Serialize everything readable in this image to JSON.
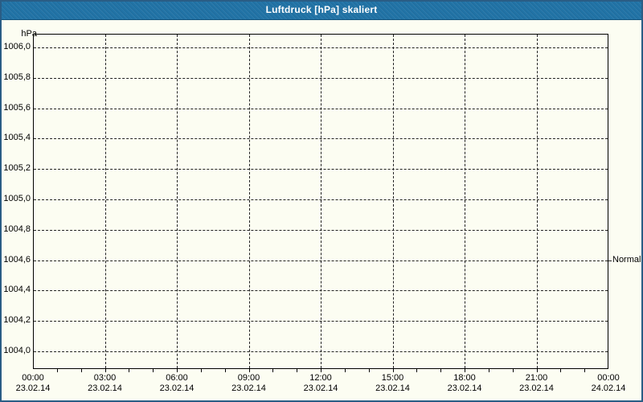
{
  "window": {
    "title": "Luftdruck [hPa] skaliert"
  },
  "colors": {
    "titlebar": "#2173a6",
    "window_border": "#2a5d85",
    "background": "#fcfdf2",
    "grid": "#222222",
    "title_text": "#ffffff",
    "axis_text": "#000000"
  },
  "y_axis": {
    "unit": "hPa"
  },
  "chart_data": {
    "type": "line",
    "title": "Luftdruck [hPa] skaliert",
    "ylabel": "hPa",
    "ylim": [
      1004.0,
      1006.0
    ],
    "ytick_step": 0.2,
    "xlim_hours": [
      0,
      24
    ],
    "xtick_step_hours": 3,
    "minor_xtick_step_hours": 1,
    "grid": true,
    "legend": "none",
    "series": [],
    "y_ticks": [
      {
        "value": 1006.0,
        "label": "1006,0"
      },
      {
        "value": 1005.8,
        "label": "1005,8"
      },
      {
        "value": 1005.6,
        "label": "1005,6"
      },
      {
        "value": 1005.4,
        "label": "1005,4"
      },
      {
        "value": 1005.2,
        "label": "1005,2"
      },
      {
        "value": 1005.0,
        "label": "1005,0"
      },
      {
        "value": 1004.8,
        "label": "1004,8"
      },
      {
        "value": 1004.6,
        "label": "1004,6"
      },
      {
        "value": 1004.4,
        "label": "1004,4"
      },
      {
        "value": 1004.2,
        "label": "1004,2"
      },
      {
        "value": 1004.0,
        "label": "1004,0"
      }
    ],
    "x_ticks": [
      {
        "hour": 0,
        "time": "00:00",
        "date": "23.02.14"
      },
      {
        "hour": 3,
        "time": "03:00",
        "date": "23.02.14"
      },
      {
        "hour": 6,
        "time": "06:00",
        "date": "23.02.14"
      },
      {
        "hour": 9,
        "time": "09:00",
        "date": "23.02.14"
      },
      {
        "hour": 12,
        "time": "12:00",
        "date": "23.02.14"
      },
      {
        "hour": 15,
        "time": "15:00",
        "date": "23.02.14"
      },
      {
        "hour": 18,
        "time": "18:00",
        "date": "23.02.14"
      },
      {
        "hour": 21,
        "time": "21:00",
        "date": "23.02.14"
      },
      {
        "hour": 24,
        "time": "00:00",
        "date": "24.02.14"
      }
    ],
    "annotations": [
      {
        "label": "Normal",
        "y": 1004.6,
        "side": "right"
      }
    ]
  }
}
